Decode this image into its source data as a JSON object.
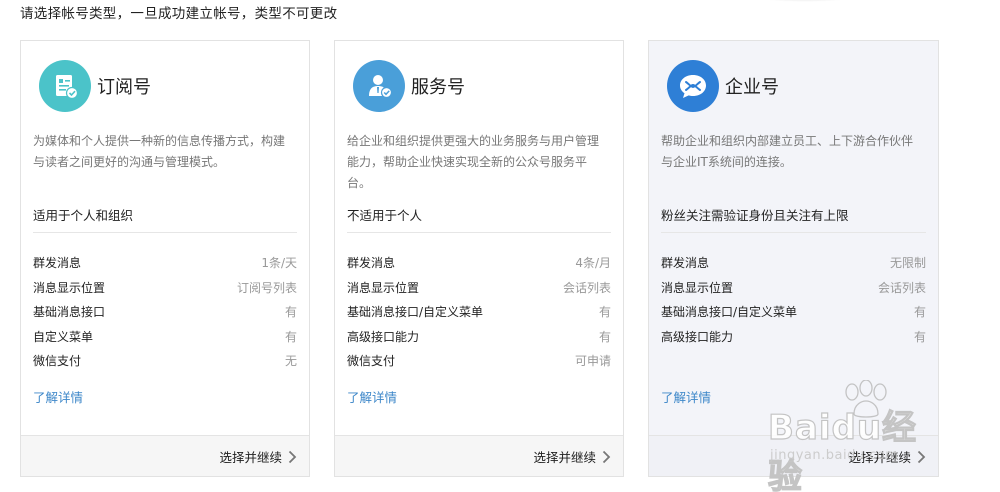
{
  "top_note": "请选择帐号类型，一旦成功建立帐号，类型不可更改",
  "cards": [
    {
      "title": "订阅号",
      "icon": "subscription-doc-icon",
      "icon_color": "#4bc3c9",
      "description": "为媒体和个人提供一种新的信息传播方式，构建与读者之间更好的沟通与管理模式。",
      "suitable": "适用于个人和组织",
      "features": [
        {
          "name": "群发消息",
          "value": "1条/天"
        },
        {
          "name": "消息显示位置",
          "value": "订阅号列表"
        },
        {
          "name": "基础消息接口",
          "value": "有"
        },
        {
          "name": "自定义菜单",
          "value": "有"
        },
        {
          "name": "微信支付",
          "value": "无"
        }
      ],
      "detail_link": "了解详情",
      "continue_label": "选择并继续"
    },
    {
      "title": "服务号",
      "icon": "service-person-icon",
      "icon_color": "#4a9fd9",
      "description": "给企业和组织提供更强大的业务服务与用户管理能力，帮助企业快速实现全新的公众号服务平台。",
      "suitable": "不适用于个人",
      "features": [
        {
          "name": "群发消息",
          "value": "4条/月"
        },
        {
          "name": "消息显示位置",
          "value": "会话列表"
        },
        {
          "name": "基础消息接口/自定义菜单",
          "value": "有"
        },
        {
          "name": "高级接口能力",
          "value": "有"
        },
        {
          "name": "微信支付",
          "value": "可申请"
        }
      ],
      "detail_link": "了解详情",
      "continue_label": "选择并继续"
    },
    {
      "title": "企业号",
      "icon": "enterprise-bubble-icon",
      "icon_color": "#2e7fd6",
      "description": "帮助企业和组织内部建立员工、上下游合作伙伴与企业IT系统间的连接。",
      "suitable": "粉丝关注需验证身份且关注有上限",
      "features": [
        {
          "name": "群发消息",
          "value": "无限制"
        },
        {
          "name": "消息显示位置",
          "value": "会话列表"
        },
        {
          "name": "基础消息接口/自定义菜单",
          "value": "有"
        },
        {
          "name": "高级接口能力",
          "value": "有"
        }
      ],
      "detail_link": "了解详情",
      "continue_label": "选择并继续"
    }
  ],
  "watermark": {
    "main": "Baidu经验",
    "sub": "jingyan.baidu.com"
  }
}
